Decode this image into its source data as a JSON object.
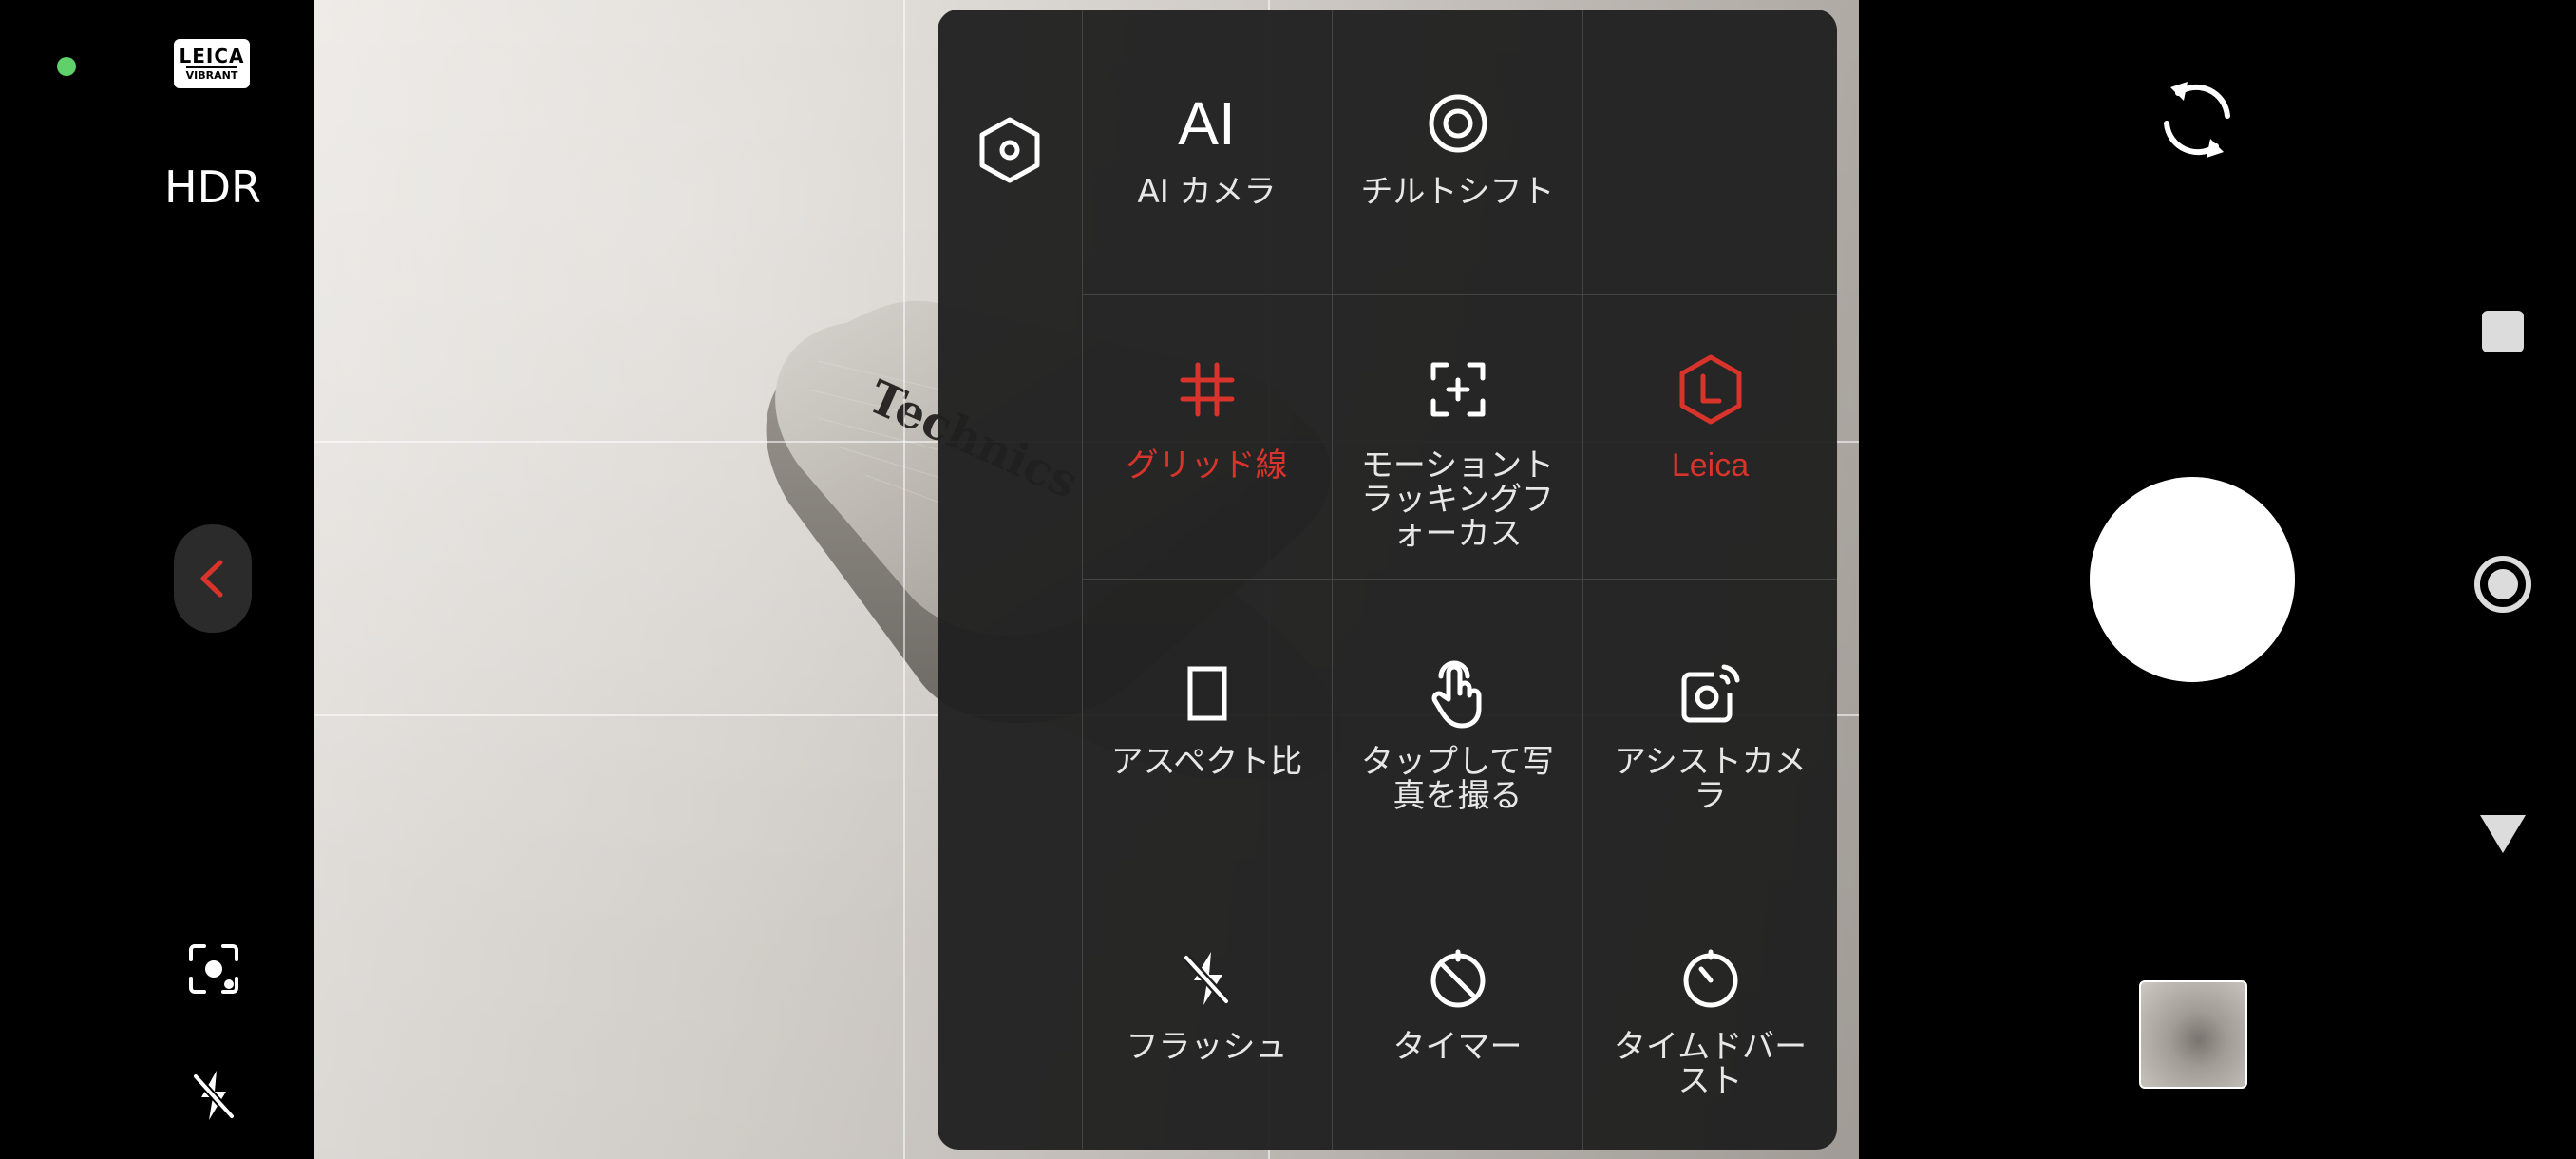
{
  "left_rail": {
    "status_dot_color": "#5fd06a",
    "leica_badge": {
      "line1": "LEICA",
      "line2": "VIBRANT"
    },
    "hdr_label": "HDR"
  },
  "panel": {
    "accent_color": "#d8342b",
    "items": [
      {
        "label": "AI カメラ",
        "icon": "ai-icon",
        "active": false
      },
      {
        "label": "チルトシフト",
        "icon": "tilt-shift-icon",
        "active": false
      },
      {
        "label": "",
        "icon": "",
        "active": false
      },
      {
        "label": "グリッド線",
        "icon": "grid-icon",
        "active": true
      },
      {
        "label": "モーショントラッキングフォーカス",
        "icon": "motion-tracking-focus-icon",
        "active": false
      },
      {
        "label": "Leica",
        "icon": "leica-hexagon-icon",
        "active": true
      },
      {
        "label": "アスペクト比",
        "icon": "aspect-ratio-icon",
        "active": false
      },
      {
        "label": "タップして写真を撮る",
        "icon": "tap-to-shoot-icon",
        "active": false
      },
      {
        "label": "アシストカメラ",
        "icon": "assist-camera-icon",
        "active": false
      },
      {
        "label": "フラッシュ",
        "icon": "flash-off-icon",
        "active": false
      },
      {
        "label": "タイマー",
        "icon": "timer-off-icon",
        "active": false
      },
      {
        "label": "タイムドバースト",
        "icon": "timed-burst-icon",
        "active": false
      }
    ],
    "ai_glyph": "AI"
  },
  "viewfinder": {
    "subject_text": "Technics"
  }
}
